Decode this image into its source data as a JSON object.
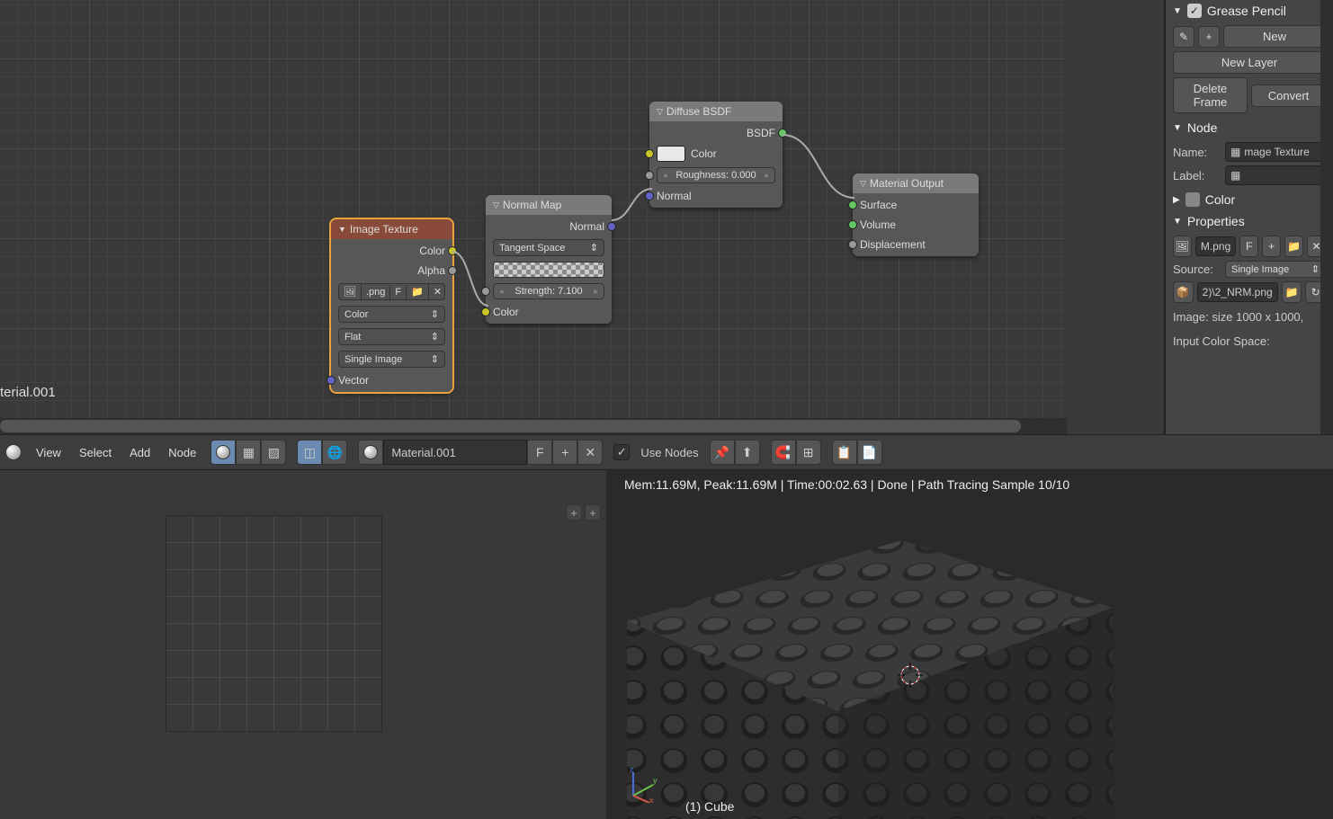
{
  "node_editor": {
    "material_label": "terial.001",
    "nodes": {
      "image_texture": {
        "title": "Image Texture",
        "color_out": "Color",
        "alpha_out": "Alpha",
        "file": ".png",
        "f_btn": "F",
        "colorspace": "Color",
        "projection": "Flat",
        "source": "Single Image",
        "vector_in": "Vector"
      },
      "normal_map": {
        "title": "Normal Map",
        "normal_out": "Normal",
        "space": "Tangent Space",
        "strength_label": "Strength: 7.100",
        "color_in": "Color"
      },
      "diffuse": {
        "title": "Diffuse BSDF",
        "bsdf_out": "BSDF",
        "color_in": "Color",
        "roughness_label": "Roughness: 0.000",
        "normal_in": "Normal"
      },
      "output": {
        "title": "Material Output",
        "surface": "Surface",
        "volume": "Volume",
        "displacement": "Displacement"
      }
    }
  },
  "sidebar": {
    "grease_pencil": {
      "title": "Grease Pencil",
      "new": "New",
      "new_layer": "New Layer",
      "delete_frame": "Delete Frame",
      "convert": "Convert"
    },
    "node_panel": {
      "title": "Node",
      "name_label": "Name:",
      "name_value": "mage Texture",
      "label_label": "Label:"
    },
    "color_panel": {
      "title": "Color"
    },
    "properties_panel": {
      "title": "Properties",
      "file": "M.png",
      "f_btn": "F",
      "source_label": "Source:",
      "source_value": "Single Image",
      "path": "2)\\2_NRM.png",
      "image_info": "Image: size 1000 x 1000,",
      "colorspace_label": "Input Color Space:"
    }
  },
  "header": {
    "menus": [
      "View",
      "Select",
      "Add",
      "Node"
    ],
    "material_name": "Material.001",
    "f_btn": "F",
    "use_nodes": "Use Nodes"
  },
  "viewport": {
    "stats": "Mem:11.69M, Peak:11.69M | Time:00:02.63 | Done | Path Tracing Sample 10/10",
    "object": "(1) Cube"
  }
}
